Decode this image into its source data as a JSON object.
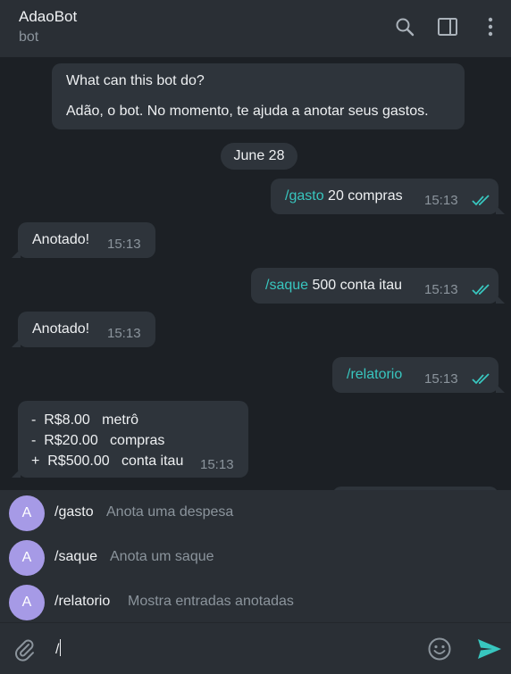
{
  "header": {
    "title": "AdaoBot",
    "subtitle": "bot",
    "icons": [
      "search-icon",
      "sidebar-toggle-icon",
      "more-vertical-icon"
    ]
  },
  "intro": {
    "question": "What can this bot do?",
    "description": "Adão, o bot. No momento, te ajuda a anotar seus gastos."
  },
  "date_separator": "June 28",
  "messages": [
    {
      "direction": "outgoing",
      "command": "/gasto",
      "text": " 20 compras",
      "time": "15:13",
      "status": "read"
    },
    {
      "direction": "incoming",
      "text": "Anotado!",
      "time": "15:13"
    },
    {
      "direction": "outgoing",
      "command": "/saque",
      "text": " 500 conta itau",
      "time": "15:13",
      "status": "read"
    },
    {
      "direction": "incoming",
      "text": "Anotado!",
      "time": "15:13"
    },
    {
      "direction": "outgoing",
      "command": "/relatorio",
      "text": "",
      "time": "15:13",
      "status": "read"
    },
    {
      "direction": "incoming",
      "lines": [
        "-  R$8.00   metrô",
        "-  R$20.00   compras",
        "+  R$500.00   conta itau"
      ],
      "time": "15:13"
    }
  ],
  "suggestions": [
    {
      "avatar": "A",
      "command": "/gasto",
      "description": "Anota uma despesa"
    },
    {
      "avatar": "A",
      "command": "/saque",
      "description": "Anota um saque"
    },
    {
      "avatar": "A",
      "command": "/relatorio",
      "description": "Mostra entradas anotadas"
    }
  ],
  "composer": {
    "value": "/",
    "icons": [
      "attach-icon",
      "emoji-icon",
      "send-icon"
    ]
  },
  "colors": {
    "accent": "#38c6bf",
    "background": "#1c2025",
    "bubble": "#2e343b",
    "panel": "#2a2f35",
    "avatar": "#a69ae6"
  }
}
